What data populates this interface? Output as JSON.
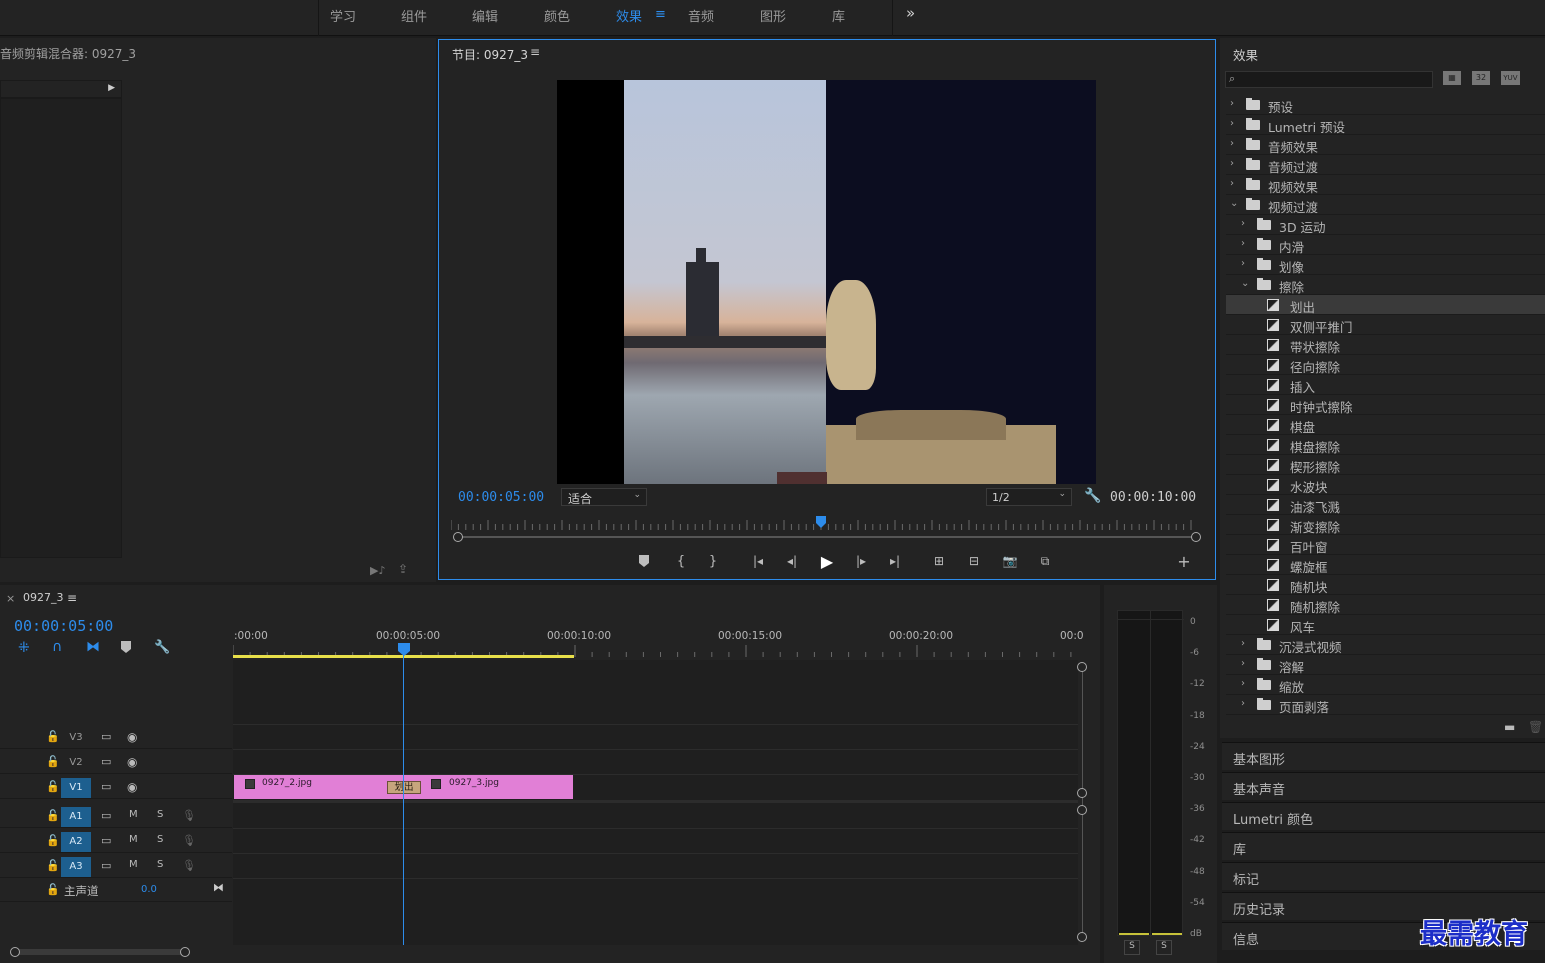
{
  "workspace_tabs": [
    "学习",
    "组件",
    "编辑",
    "颜色",
    "效果",
    "音频",
    "图形",
    "库"
  ],
  "workspace_active": "效果",
  "workspace_more": "»",
  "audio_mixer": {
    "title": "音频剪辑混合器: 0927_3"
  },
  "program": {
    "title": "节目: 0927_3",
    "menu": "≡",
    "timecode_in": "00:00:05:00",
    "zoom_value": "适合",
    "resolution_value": "1/2",
    "timecode_dur": "00:00:10:00",
    "playhead_fraction": 0.5
  },
  "effects": {
    "title": "效果",
    "search_placeholder": "",
    "tool_icons": [
      "new-bin-icon",
      "32-bit-icon",
      "yuv-icon"
    ],
    "top_items": [
      {
        "label": "预设",
        "expanded": false
      },
      {
        "label": "Lumetri 预设",
        "expanded": false
      },
      {
        "label": "音频效果",
        "expanded": false
      },
      {
        "label": "音频过渡",
        "expanded": false
      },
      {
        "label": "视频效果",
        "expanded": false
      },
      {
        "label": "视频过渡",
        "expanded": true
      }
    ],
    "video_transition_bins": [
      "3D 运动",
      "内滑",
      "划像",
      "擦除"
    ],
    "wipe_items": [
      "划出",
      "双侧平推门",
      "带状擦除",
      "径向擦除",
      "插入",
      "时钟式擦除",
      "棋盘",
      "棋盘擦除",
      "楔形擦除",
      "水波块",
      "油漆飞溅",
      "渐变擦除",
      "百叶窗",
      "螺旋框",
      "随机块",
      "随机擦除",
      "风车"
    ],
    "selected_item": "划出",
    "trailing_bins": [
      "沉浸式视频",
      "溶解",
      "缩放",
      "页面剥落"
    ]
  },
  "side_panels": [
    "基本图形",
    "基本声音",
    "Lumetri 颜色",
    "库",
    "标记",
    "历史记录",
    "信息"
  ],
  "timeline": {
    "tab_label": "0927_3",
    "close": "×",
    "menu": "≡",
    "timecode": "00:00:05:00",
    "ruler": [
      ":00:00",
      "00:00:05:00",
      "00:00:10:00",
      "00:00:15:00",
      "00:00:20:00",
      "00:0"
    ],
    "video_tracks": [
      {
        "label": "V3",
        "active": false
      },
      {
        "label": "V2",
        "active": false
      },
      {
        "label": "V1",
        "active": true
      }
    ],
    "audio_tracks": [
      {
        "label": "A1",
        "m": "M",
        "s": "S"
      },
      {
        "label": "A2",
        "m": "M",
        "s": "S"
      },
      {
        "label": "A3",
        "m": "M",
        "s": "S"
      }
    ],
    "master": {
      "label": "主声道",
      "value": "0.0"
    },
    "clips": [
      {
        "name": "0927_2.jpg"
      },
      {
        "name": "0927_3.jpg"
      }
    ],
    "transition_label": "划出"
  },
  "meter": {
    "scale": [
      "0",
      "-6",
      "-12",
      "-18",
      "-24",
      "-30",
      "-36",
      "-42",
      "-48",
      "-54",
      "dB"
    ],
    "solo": [
      "S",
      "S"
    ]
  },
  "watermark": "最需教育",
  "colors": {
    "accent": "#2d8ceb",
    "clip": "#e17fd6",
    "work_area": "#e8e04a"
  }
}
